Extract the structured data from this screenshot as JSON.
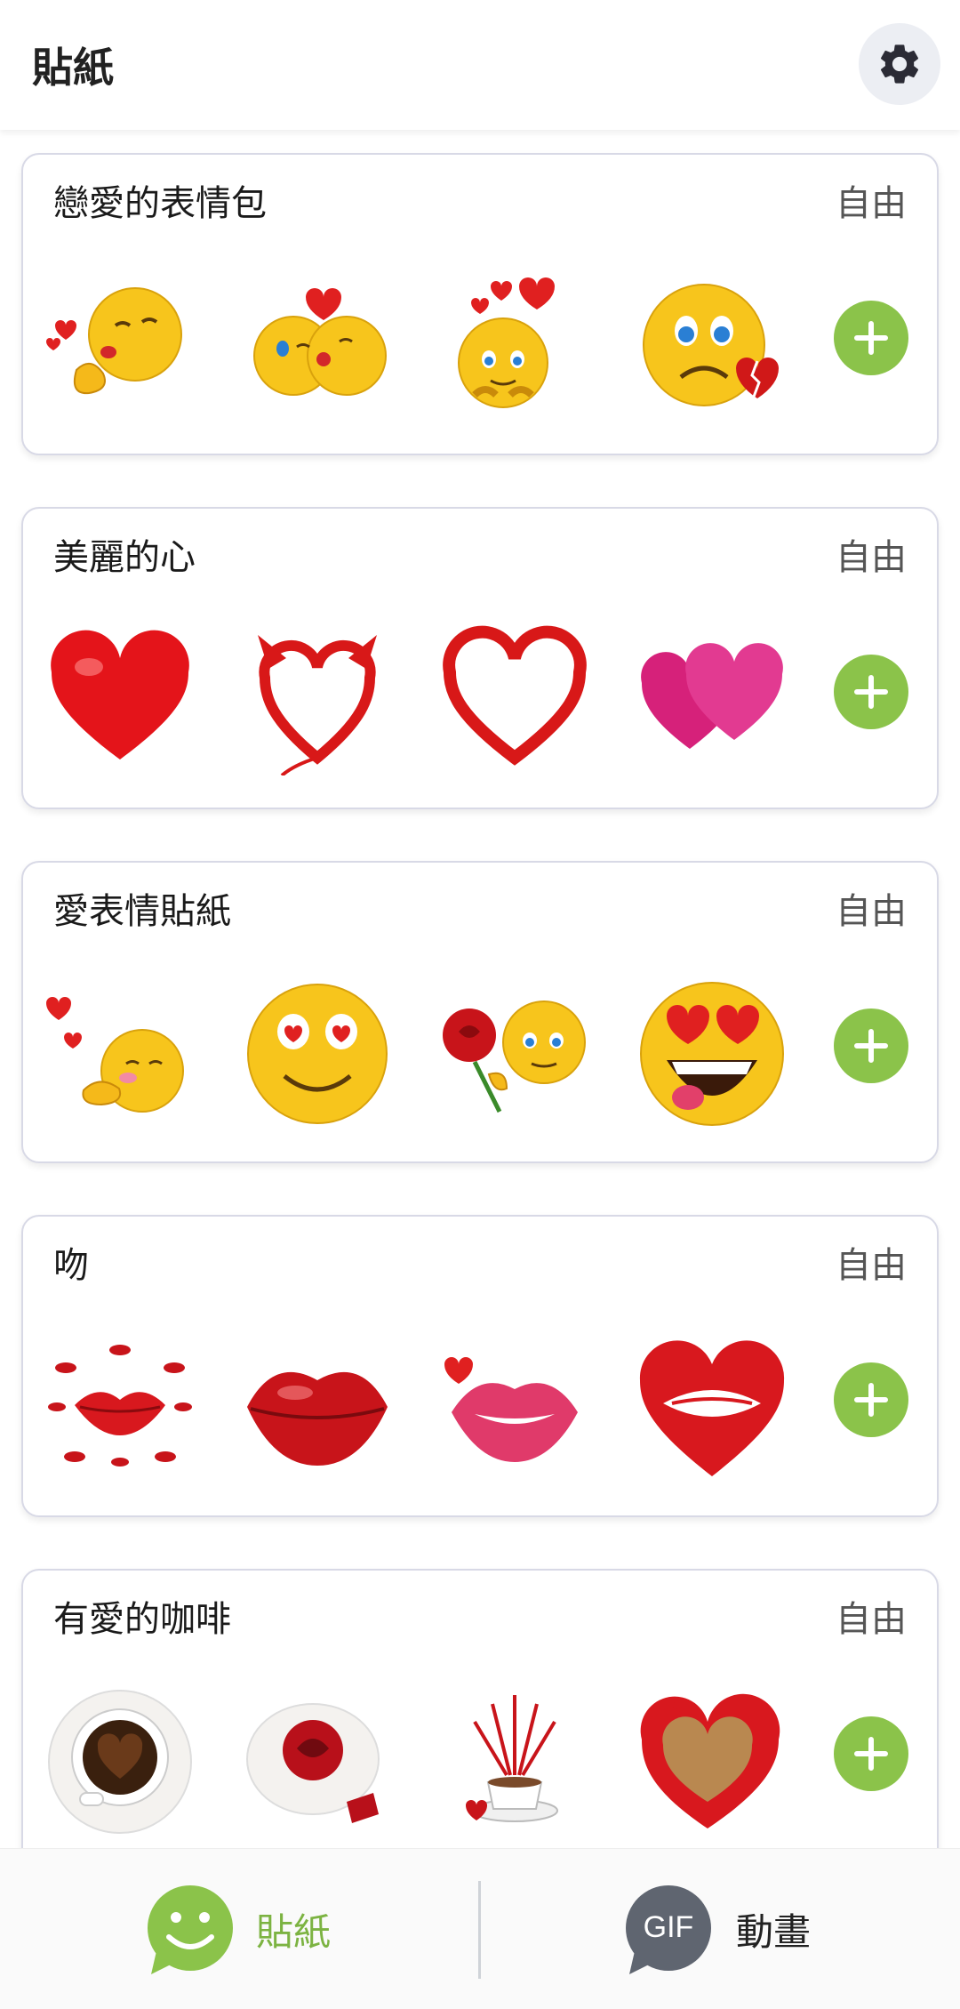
{
  "header": {
    "title": "貼紙",
    "settings_icon": "gear-icon"
  },
  "packs": [
    {
      "title": "戀愛的表情包",
      "price": "自由",
      "stickers": [
        "kissing-face-sticker",
        "couple-kiss-sticker",
        "shy-face-hearts-sticker",
        "sad-broken-heart-sticker"
      ]
    },
    {
      "title": "美麗的心",
      "price": "自由",
      "stickers": [
        "red-heart-sticker",
        "devil-heart-sticker",
        "outline-heart-sticker",
        "pink-double-heart-sticker"
      ]
    },
    {
      "title": "愛表情貼紙",
      "price": "自由",
      "stickers": [
        "blowing-kiss-sticker",
        "heart-eyes-face-sticker",
        "rose-face-sticker",
        "laughing-heart-eyes-sticker"
      ]
    },
    {
      "title": "吻",
      "price": "自由",
      "stickers": [
        "lips-ring-sticker",
        "red-lips-sticker",
        "pink-lips-sticker",
        "heart-lips-sticker"
      ]
    },
    {
      "title": "有愛的咖啡",
      "price": "自由",
      "stickers": [
        "coffee-heart-sticker",
        "rose-cup-sticker",
        "coffee-arrows-sticker",
        "heart-cup-sticker"
      ]
    }
  ],
  "bottom_nav": {
    "stickers_label": "貼紙",
    "animation_label": "動畫",
    "gif_badge": "GIF"
  },
  "colors": {
    "accent": "#8bc34a",
    "emoji_yellow": "#f5c218",
    "heart_red": "#e01010"
  }
}
